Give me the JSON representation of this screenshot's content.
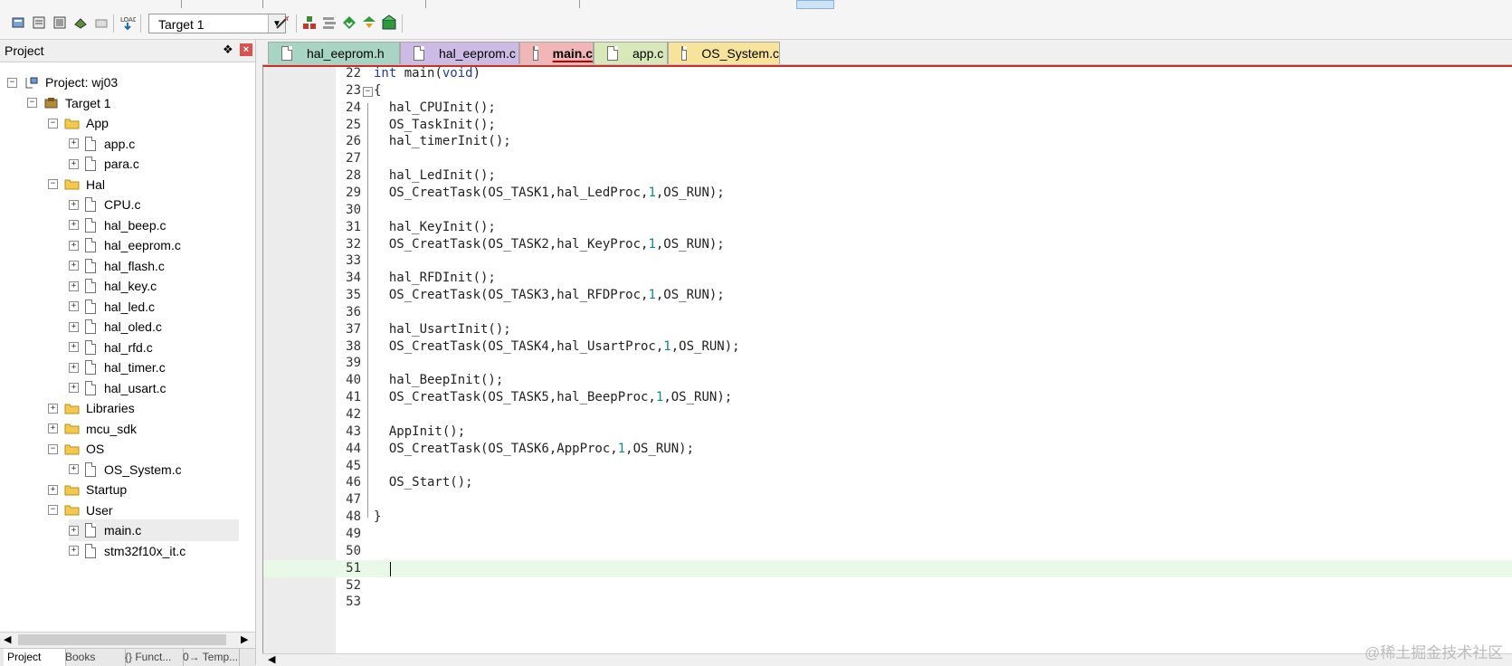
{
  "toolbar": {
    "target": "Target 1",
    "icons": [
      "build-icon",
      "rebuild-icon",
      "batch-build-icon",
      "stop-build-icon",
      "download-icon",
      "flash-load-icon",
      "options-wand-icon",
      "manage-components-icon",
      "manage-project-items-icon",
      "select-packs-icon",
      "pack-installer-icon",
      "rte-icon"
    ]
  },
  "project_panel": {
    "title": "Project",
    "pin": "❖",
    "close": "×",
    "tree": [
      {
        "level": 0,
        "kind": "project",
        "label": "Project: wj03",
        "expander": "−"
      },
      {
        "level": 1,
        "kind": "target",
        "label": "Target 1",
        "expander": "−"
      },
      {
        "level": 2,
        "kind": "folder",
        "label": "App",
        "expander": "−"
      },
      {
        "level": 3,
        "kind": "file",
        "label": "app.c",
        "expander": "+"
      },
      {
        "level": 3,
        "kind": "file",
        "label": "para.c",
        "expander": "+"
      },
      {
        "level": 2,
        "kind": "folder",
        "label": "Hal",
        "expander": "−"
      },
      {
        "level": 3,
        "kind": "file",
        "label": "CPU.c",
        "expander": "+"
      },
      {
        "level": 3,
        "kind": "file",
        "label": "hal_beep.c",
        "expander": "+"
      },
      {
        "level": 3,
        "kind": "file",
        "label": "hal_eeprom.c",
        "expander": "+"
      },
      {
        "level": 3,
        "kind": "file",
        "label": "hal_flash.c",
        "expander": "+"
      },
      {
        "level": 3,
        "kind": "file",
        "label": "hal_key.c",
        "expander": "+"
      },
      {
        "level": 3,
        "kind": "file",
        "label": "hal_led.c",
        "expander": "+"
      },
      {
        "level": 3,
        "kind": "file",
        "label": "hal_oled.c",
        "expander": "+"
      },
      {
        "level": 3,
        "kind": "file",
        "label": "hal_rfd.c",
        "expander": "+"
      },
      {
        "level": 3,
        "kind": "file",
        "label": "hal_timer.c",
        "expander": "+"
      },
      {
        "level": 3,
        "kind": "file",
        "label": "hal_usart.c",
        "expander": "+"
      },
      {
        "level": 2,
        "kind": "folder",
        "label": "Libraries",
        "expander": "+"
      },
      {
        "level": 2,
        "kind": "folder",
        "label": "mcu_sdk",
        "expander": "+"
      },
      {
        "level": 2,
        "kind": "folder",
        "label": "OS",
        "expander": "−"
      },
      {
        "level": 3,
        "kind": "file",
        "label": "OS_System.c",
        "expander": "+"
      },
      {
        "level": 2,
        "kind": "folder",
        "label": "Startup",
        "expander": "+"
      },
      {
        "level": 2,
        "kind": "folder",
        "label": "User",
        "expander": "−"
      },
      {
        "level": 3,
        "kind": "file",
        "label": "main.c",
        "expander": "+",
        "selected": true
      },
      {
        "level": 3,
        "kind": "file",
        "label": "stm32f10x_it.c",
        "expander": "+"
      }
    ],
    "scroll_left": "◀",
    "scroll_right": "▶",
    "bottom_tabs": [
      {
        "label": "Project",
        "icon": "project-icon",
        "active": true
      },
      {
        "label": "Books",
        "icon": "books-icon"
      },
      {
        "label": "{} Funct...",
        "icon": "functions-icon"
      },
      {
        "label": "0→ Temp...",
        "icon": "templates-icon"
      }
    ]
  },
  "editor": {
    "tabs": [
      {
        "label": "hal_eeprom.h",
        "color": "#a8d4c3",
        "width": 146
      },
      {
        "label": "hal_eeprom.c",
        "color": "#cdbbe6",
        "width": 132
      },
      {
        "label": "main.c",
        "color": "#f2b6b6",
        "width": 82,
        "active": true
      },
      {
        "label": "app.c",
        "color": "#d8e8b8",
        "width": 82
      },
      {
        "label": "OS_System.c",
        "color": "#f7e49a",
        "width": 124
      }
    ],
    "lines": [
      {
        "n": "22",
        "parts": [
          [
            "kw",
            "int"
          ],
          [
            "t",
            " main("
          ],
          [
            "kw",
            "void"
          ],
          [
            "t",
            ")"
          ]
        ]
      },
      {
        "n": "23",
        "fold": "−",
        "parts": [
          [
            "t",
            "{"
          ]
        ]
      },
      {
        "n": "24",
        "parts": [
          [
            "t",
            "  hal_CPUInit();"
          ]
        ]
      },
      {
        "n": "25",
        "parts": [
          [
            "t",
            "  OS_TaskInit();"
          ]
        ]
      },
      {
        "n": "26",
        "parts": [
          [
            "t",
            "  hal_timerInit();"
          ]
        ]
      },
      {
        "n": "27",
        "parts": []
      },
      {
        "n": "28",
        "parts": [
          [
            "t",
            "  hal_LedInit();"
          ]
        ]
      },
      {
        "n": "29",
        "parts": [
          [
            "t",
            "  OS_CreatTask(OS_TASK1,hal_LedProc,"
          ],
          [
            "num",
            "1"
          ],
          [
            "t",
            ",OS_RUN);"
          ]
        ]
      },
      {
        "n": "30",
        "parts": []
      },
      {
        "n": "31",
        "parts": [
          [
            "t",
            "  hal_KeyInit();"
          ]
        ]
      },
      {
        "n": "32",
        "parts": [
          [
            "t",
            "  OS_CreatTask(OS_TASK2,hal_KeyProc,"
          ],
          [
            "num",
            "1"
          ],
          [
            "t",
            ",OS_RUN);"
          ]
        ]
      },
      {
        "n": "33",
        "parts": []
      },
      {
        "n": "34",
        "parts": [
          [
            "t",
            "  hal_RFDInit();"
          ]
        ]
      },
      {
        "n": "35",
        "parts": [
          [
            "t",
            "  OS_CreatTask(OS_TASK3,hal_RFDProc,"
          ],
          [
            "num",
            "1"
          ],
          [
            "t",
            ",OS_RUN);"
          ]
        ]
      },
      {
        "n": "36",
        "parts": []
      },
      {
        "n": "37",
        "parts": [
          [
            "t",
            "  hal_UsartInit();"
          ]
        ]
      },
      {
        "n": "38",
        "parts": [
          [
            "t",
            "  OS_CreatTask(OS_TASK4,hal_UsartProc,"
          ],
          [
            "num",
            "1"
          ],
          [
            "t",
            ",OS_RUN);"
          ]
        ]
      },
      {
        "n": "39",
        "parts": []
      },
      {
        "n": "40",
        "parts": [
          [
            "t",
            "  hal_BeepInit();"
          ]
        ]
      },
      {
        "n": "41",
        "parts": [
          [
            "t",
            "  OS_CreatTask(OS_TASK5,hal_BeepProc,"
          ],
          [
            "num",
            "1"
          ],
          [
            "t",
            ",OS_RUN);"
          ]
        ]
      },
      {
        "n": "42",
        "parts": []
      },
      {
        "n": "43",
        "parts": [
          [
            "t",
            "  AppInit();"
          ]
        ]
      },
      {
        "n": "44",
        "parts": [
          [
            "t",
            "  OS_CreatTask(OS_TASK6,AppProc,"
          ],
          [
            "num",
            "1"
          ],
          [
            "t",
            ",OS_RUN);"
          ]
        ]
      },
      {
        "n": "45",
        "parts": []
      },
      {
        "n": "46",
        "parts": [
          [
            "t",
            "  OS_Start();"
          ]
        ]
      },
      {
        "n": "47",
        "parts": []
      },
      {
        "n": "48",
        "parts": [
          [
            "t",
            "}"
          ]
        ]
      },
      {
        "n": "49",
        "parts": []
      },
      {
        "n": "50",
        "parts": []
      },
      {
        "n": "51",
        "parts": [],
        "current": true
      },
      {
        "n": "52",
        "parts": []
      },
      {
        "n": "53",
        "parts": []
      }
    ],
    "scroll_left": "◀"
  },
  "watermark": "@稀土掘金技术社区"
}
